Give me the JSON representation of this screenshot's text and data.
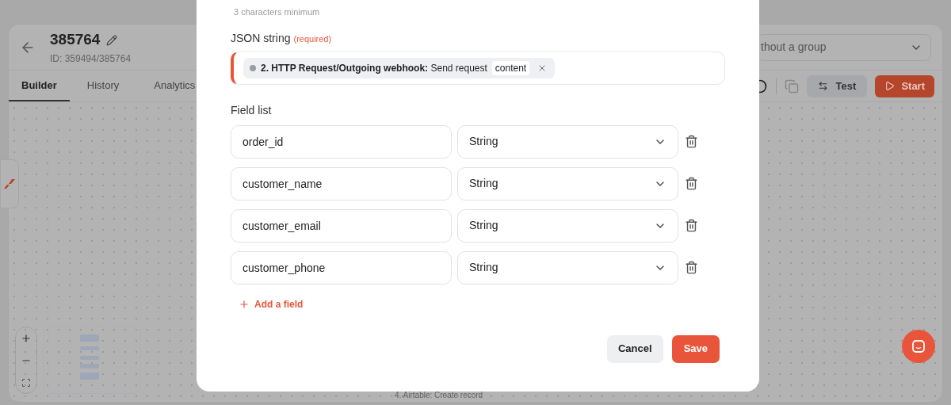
{
  "app": {
    "title": "385764",
    "id_line": "ID: 359494/385764",
    "group_select": {
      "value": "thout a group"
    },
    "tabs": [
      {
        "label": "Builder",
        "selected": true
      },
      {
        "label": "History",
        "selected": false
      },
      {
        "label": "Analytics",
        "selected": false
      }
    ],
    "toolbar": {
      "test_button": "Test",
      "start_button": "Start"
    },
    "canvas": {
      "node_label": "4. Airtable: Create record"
    }
  },
  "dialog": {
    "hint": "3 characters minimum",
    "json_field": {
      "label": "JSON string",
      "required_note": "(required)",
      "token": {
        "text": "**2. HTTP Request/Outgoing webhook:** Send request",
        "tag": "content"
      }
    },
    "field_list": {
      "label": "Field list",
      "fields": [
        {
          "name": "order_id",
          "type": "String"
        },
        {
          "name": "customer_name",
          "type": "String"
        },
        {
          "name": "customer_email",
          "type": "String"
        },
        {
          "name": "customer_phone",
          "type": "String"
        }
      ]
    },
    "add_button": "Add a field",
    "buttons": {
      "cancel": "Cancel",
      "save": "Save"
    }
  }
}
